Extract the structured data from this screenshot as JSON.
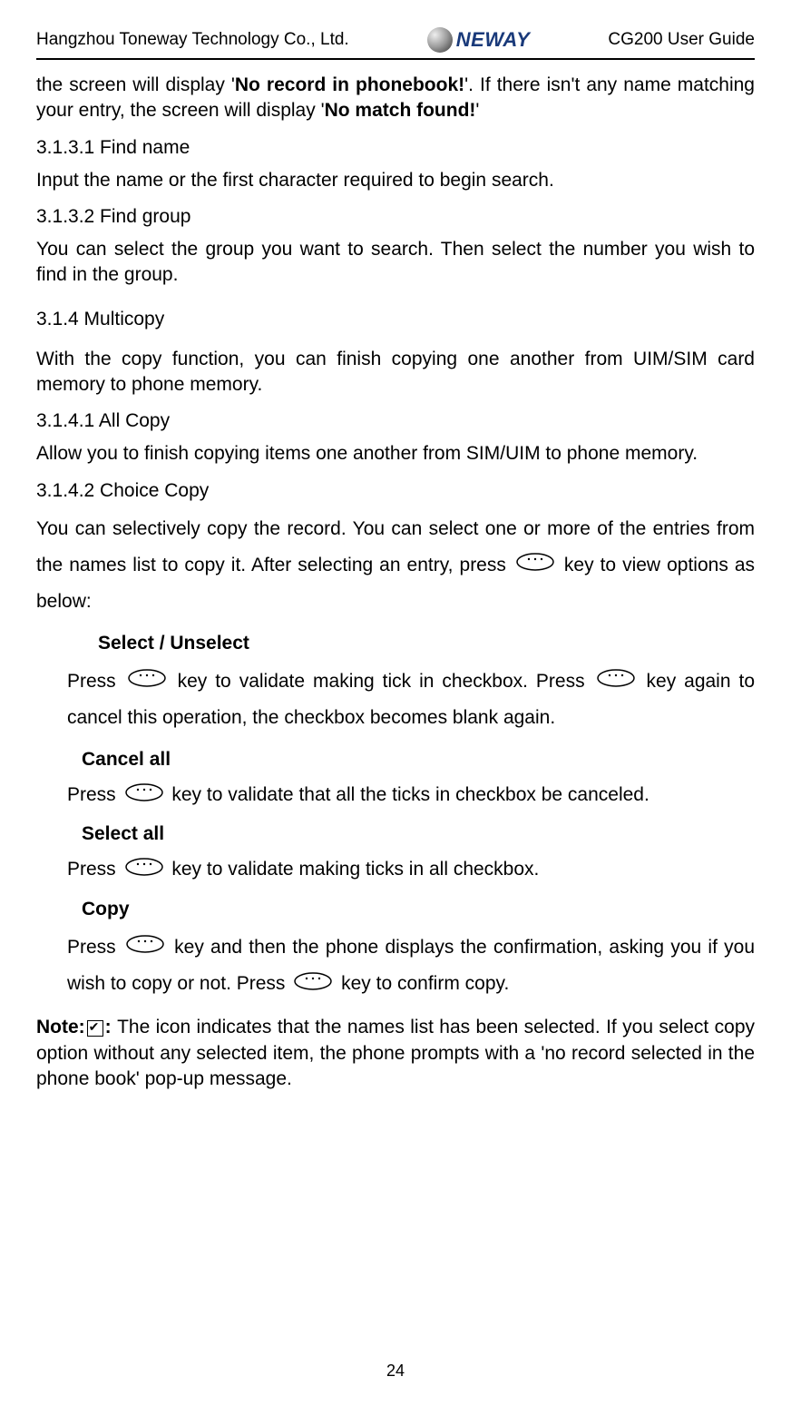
{
  "header": {
    "company": "Hangzhou Toneway Technology Co., Ltd.",
    "logo_text": "NEWAY",
    "guide": "CG200 User Guide"
  },
  "intro_para": {
    "pre": "the screen will display '",
    "bold1": "No record in phonebook!",
    "mid": "'. If there isn't any name matching your entry, the screen will display '",
    "bold2": "No match found!",
    "post": "'"
  },
  "s3131": {
    "heading": "3.1.3.1 Find name",
    "body": "Input the name or the first character required to begin search."
  },
  "s3132": {
    "heading": "3.1.3.2 Find group",
    "body": "You can select the group you want to search. Then select the number you wish to find in the group."
  },
  "s314": {
    "heading": "3.1.4 Multicopy",
    "body": "With the copy function, you can finish copying one another from UIM/SIM card memory to phone memory."
  },
  "s3141": {
    "heading": "3.1.4.1 All Copy",
    "body": "Allow you to finish copying items one another from SIM/UIM to phone memory."
  },
  "s3142": {
    "heading": "3.1.4.2 Choice Copy",
    "intro": {
      "p1a": "You can selectively copy the record. You can select one or more of the entries from the names list to copy it. After selecting an entry, press ",
      "p1b": " key to view options as below:"
    },
    "options": {
      "select_unselect": {
        "label": "Select / Unselect",
        "t1": "Press ",
        "t2": "key to validate making tick in checkbox. Press ",
        "t3": " key again to cancel this operation, the checkbox becomes blank again."
      },
      "cancel_all": {
        "label": "Cancel all",
        "t1": "Press ",
        "t2": " key to validate that all the ticks in checkbox be canceled."
      },
      "select_all": {
        "label": "Select all",
        "t1": "Press ",
        "t2": " key to validate making ticks in all checkbox."
      },
      "copy": {
        "label": "Copy",
        "t1": "Press ",
        "t2": " key and then the phone displays the confirmation, asking you if you wish to copy or not. Press ",
        "t3": " key to confirm copy."
      }
    }
  },
  "note": {
    "lead": "Note:",
    "colon": ": ",
    "body": "The icon indicates that the names list has been selected. If you select copy option without any selected item, the phone prompts with a 'no record selected in the phone book' pop-up message."
  },
  "page_number": "24"
}
